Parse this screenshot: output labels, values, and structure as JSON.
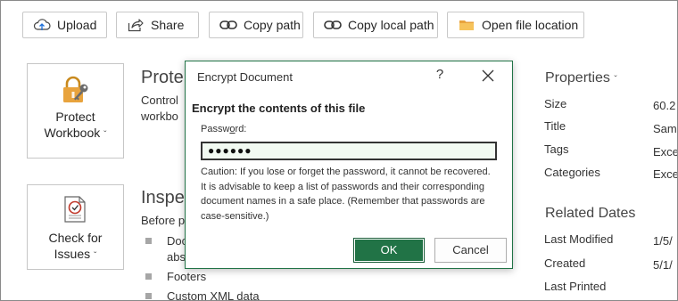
{
  "toolbar": {
    "upload": "Upload",
    "share": "Share",
    "copy_path": "Copy path",
    "copy_local_path": "Copy local path",
    "open_file_location": "Open file location"
  },
  "protect": {
    "button_line1": "Protect",
    "button_line2": "Workbook",
    "title": "Prote",
    "desc_line1": "Control",
    "desc_line2": "workbo"
  },
  "inspect": {
    "button_line1": "Check for",
    "button_line2": "Issues",
    "title": "Inspe",
    "desc": "Before p",
    "items": [
      "Doc",
      "abs",
      "Footers",
      "Custom XML data"
    ]
  },
  "properties": {
    "heading": "Properties",
    "rows": [
      {
        "label": "Size",
        "value": "60.2"
      },
      {
        "label": "Title",
        "value": "Sam"
      },
      {
        "label": "Tags",
        "value": "Exce"
      },
      {
        "label": "Categories",
        "value": "Exce"
      }
    ],
    "related_dates_heading": "Related Dates",
    "dates": [
      {
        "label": "Last Modified",
        "value": "1/5/"
      },
      {
        "label": "Created",
        "value": "5/1/"
      },
      {
        "label": "Last Printed",
        "value": ""
      }
    ]
  },
  "dialog": {
    "title": "Encrypt Document",
    "help": "?",
    "heading": "Encrypt the contents of this file",
    "password_label_pre": "Passw",
    "password_label_key": "o",
    "password_label_post": "rd:",
    "password_value": "●●●●●●",
    "caution": "Caution: If you lose or forget the password, it cannot be recovered. It is advisable to keep a list of passwords and their corresponding document names in a safe place. (Remember that passwords are case-sensitive.)",
    "ok": "OK",
    "cancel": "Cancel"
  },
  "colors": {
    "accent": "#217346",
    "folder": "#e8a33d",
    "lock": "#e8a33d"
  }
}
